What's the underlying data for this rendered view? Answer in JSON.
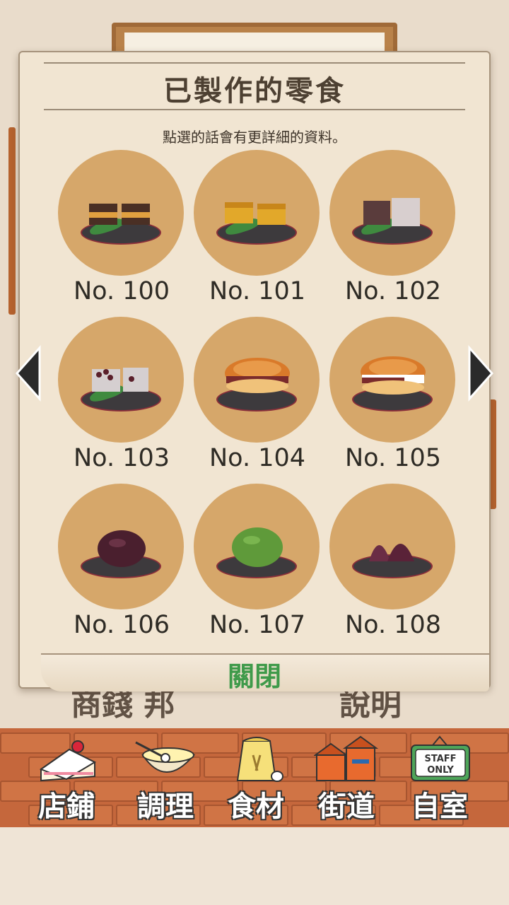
{
  "panel": {
    "title": "已製作的零食",
    "subtitle": "點選的話會有更詳細的資料。",
    "close_label": "關閉"
  },
  "items": [
    {
      "label": "No. 100",
      "food": "dark-cake-slices"
    },
    {
      "label": "No. 101",
      "food": "yellow-cake-slices"
    },
    {
      "label": "No. 102",
      "food": "dark-and-white-cubes"
    },
    {
      "label": "No. 103",
      "food": "bean-filled-cubes"
    },
    {
      "label": "No. 104",
      "food": "dorayaki"
    },
    {
      "label": "No. 105",
      "food": "cream-dorayaki"
    },
    {
      "label": "No. 106",
      "food": "red-bean-mochi"
    },
    {
      "label": "No. 107",
      "food": "green-mochi"
    },
    {
      "label": "No. 108",
      "food": "purple-dumplings"
    }
  ],
  "nav": [
    {
      "label": "店鋪",
      "icon": "cake-icon"
    },
    {
      "label": "調理",
      "icon": "mixing-bowl-icon"
    },
    {
      "label": "食材",
      "icon": "flour-sack-icon"
    },
    {
      "label": "街道",
      "icon": "town-icon"
    },
    {
      "label": "自室",
      "icon": "staff-only-sign-icon",
      "sign_text": "STAFF ONLY"
    }
  ],
  "background": {
    "left_text": "商錢 邦",
    "right_text": "說明"
  },
  "colors": {
    "disc": "#d6a76a",
    "close": "#3f9a4a",
    "brick": "#c5673c"
  }
}
